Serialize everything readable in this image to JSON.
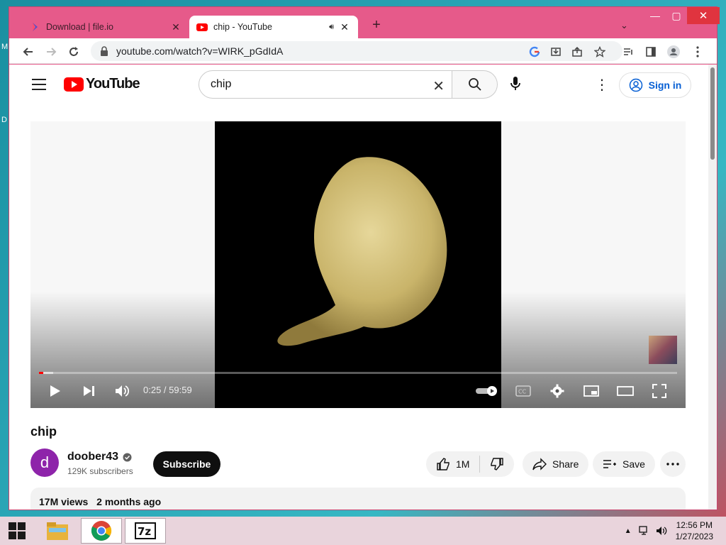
{
  "desktop": {
    "letters": [
      "M",
      "D"
    ]
  },
  "browser": {
    "tabs": [
      {
        "title": "Download | file.io",
        "active": false
      },
      {
        "title": "chip - YouTube",
        "active": true
      }
    ],
    "url": "youtube.com/watch?v=WIRK_pGdIdA"
  },
  "youtube": {
    "logo_text": "YouTube",
    "search_query": "chip",
    "sign_in": "Sign in",
    "player": {
      "time": "0:25 / 59:59",
      "progress_fraction": 0.007,
      "buffer_fraction": 0.022
    },
    "video_title": "chip",
    "channel": {
      "avatar_letter": "d",
      "name": "doober43",
      "subscribers": "129K subscribers",
      "avatar_color": "#8e24aa"
    },
    "subscribe_label": "Subscribe",
    "likes": "1M",
    "share_label": "Share",
    "save_label": "Save",
    "views": "17M views",
    "posted": "2 months ago"
  },
  "taskbar": {
    "time": "12:56 PM",
    "date": "1/27/2023",
    "apps": [
      "file-explorer-icon",
      "chrome-icon",
      "7zip-icon"
    ]
  }
}
